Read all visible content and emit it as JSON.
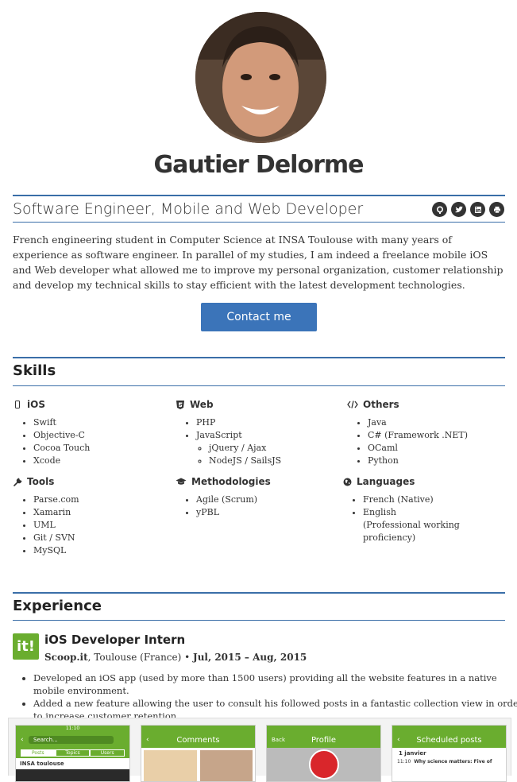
{
  "profile": {
    "name": "Gautier Delorme",
    "subtitle": "Software Engineer, Mobile and Web Developer",
    "social_icons": [
      "github-icon",
      "twitter-icon",
      "linkedin-icon",
      "print-icon"
    ],
    "intro": "French engineering student in Computer Science at INSA Toulouse with many years of experience as software engineer. In parallel of my studies, I am indeed a freelance mobile iOS and Web developer what allowed me to improve my personal organization, customer relationship and develop my technical skills to stay efficient with the latest development technologies.",
    "contact_label": "Contact me"
  },
  "skills": {
    "title": "Skills",
    "ios": {
      "label": "iOS",
      "items": [
        "Swift",
        "Objective-C",
        "Cocoa Touch",
        "Xcode"
      ]
    },
    "web": {
      "label": "Web",
      "items": [
        "PHP",
        "JavaScript"
      ],
      "sub": [
        "jQuery / Ajax",
        "NodeJS / SailsJS"
      ]
    },
    "others": {
      "label": "Others",
      "items": [
        "Java",
        "C# (Framework .NET)",
        "OCaml",
        "Python"
      ]
    },
    "tools": {
      "label": "Tools",
      "items": [
        "Parse.com",
        "Xamarin",
        "UML",
        "Git / SVN",
        "MySQL"
      ]
    },
    "methodologies": {
      "label": "Methodologies",
      "items": [
        "Agile (Scrum)",
        "yPBL"
      ]
    },
    "languages": {
      "label": "Languages",
      "items": [
        "French (Native)",
        "English",
        "(Professional working proficiency)"
      ]
    }
  },
  "experience": {
    "title": "Experience",
    "job": {
      "logo_text": "it!",
      "title": "iOS Developer Intern",
      "company": "Scoop.it",
      "location": ", Toulouse (France) • ",
      "dates": "Jul, 2015 – Aug, 2015",
      "bullets": [
        "Developed an iOS app (used by more than 1500 users) providing all the website features in a native mobile environment.",
        "Added a new feature allowing the user to consult his followed posts in a fantastic collection view in order to increase customer retention."
      ]
    },
    "screens": {
      "status_time": "11:10",
      "s1": {
        "search": "Search...",
        "tabs": [
          "Posts",
          "Topics",
          "Users"
        ],
        "row": "INSA toulouse"
      },
      "s2": {
        "title": "Comments"
      },
      "s3": {
        "back": "Back",
        "title": "Profile"
      },
      "s4": {
        "title": "Scheduled posts",
        "date": "1 janvier",
        "time": "11:10",
        "post": "Why science matters: Five of"
      }
    }
  },
  "colors": {
    "accent": "#3a6ea8",
    "button": "#3b74b9",
    "scoopit_green": "#6aad2f"
  }
}
